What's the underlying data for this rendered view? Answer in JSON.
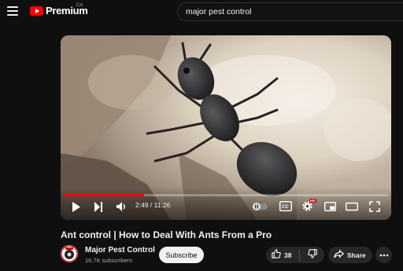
{
  "header": {
    "logo_text": "Premium",
    "logo_country": "CA",
    "search_query": "major pest control"
  },
  "player": {
    "current_time": "2:49",
    "duration": "11:26",
    "time_display": "2:49 / 11:26",
    "progress_fraction": 0.247,
    "hd_badge": "HD"
  },
  "video": {
    "title": "Ant control | How to Deal With Ants From a Pro"
  },
  "channel": {
    "name": "Major Pest Control",
    "subscribers": "16.7K subscribers",
    "subscribe_label": "Subscribe"
  },
  "actions": {
    "like_count": "38",
    "share_label": "Share"
  },
  "colors": {
    "brand_red": "#ff0000",
    "background": "#0f0f0f",
    "button_bg": "#272727"
  }
}
